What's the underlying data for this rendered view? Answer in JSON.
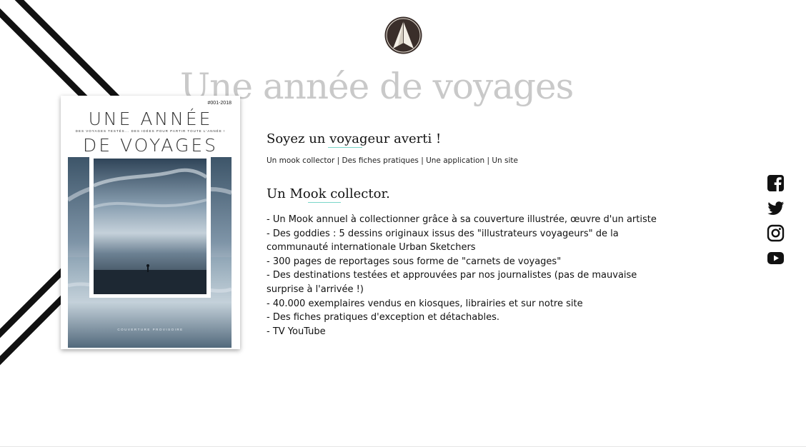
{
  "hero": {
    "title": "Une année de voyages"
  },
  "logo": {
    "icon": "paper-plane-logo-icon"
  },
  "cover": {
    "issue": "#001-2018",
    "title_line1": "UNE ANNÉE",
    "subtitle": "DES VOYAGES TESTÉS... DES IDÉES POUR PARTIR TOUTE L'ANNÉE !",
    "title_line2": "DE VOYAGES",
    "caption": "COUVERTURE PROVISOIRE"
  },
  "intro": {
    "heading": "Soyez un voyageur averti !",
    "tagline": "Un mook collector | Des fiches pratiques | Une application | Un site"
  },
  "mook": {
    "heading": "Un Mook collector.",
    "features": [
      "- Un Mook annuel à collectionner grâce à sa couverture illustrée, œuvre d'un artiste",
      "- Des goddies : 5 dessins originaux issus des \"illustrateurs voyageurs\" de la communauté internationale Urban Sketchers",
      "- 300 pages de reportages sous forme de \"carnets de voyages\"",
      "- Des destinations testées et approuvées par nos journalistes (pas de mauvaise surprise à l'arrivée !)",
      "- 40.000 exemplaires vendus en kiosques, librairies et sur notre site",
      "- Des fiches pratiques d'exception et détachables.",
      "- TV YouTube"
    ]
  },
  "social": {
    "items": [
      {
        "icon": "facebook-icon"
      },
      {
        "icon": "twitter-icon"
      },
      {
        "icon": "instagram-icon"
      },
      {
        "icon": "youtube-icon"
      }
    ]
  },
  "colors": {
    "accent_underline": "#7ad6c9",
    "hero_title": "#c9c9c9",
    "stripes": "#111111",
    "logo_bg": "#3a2e2a"
  }
}
